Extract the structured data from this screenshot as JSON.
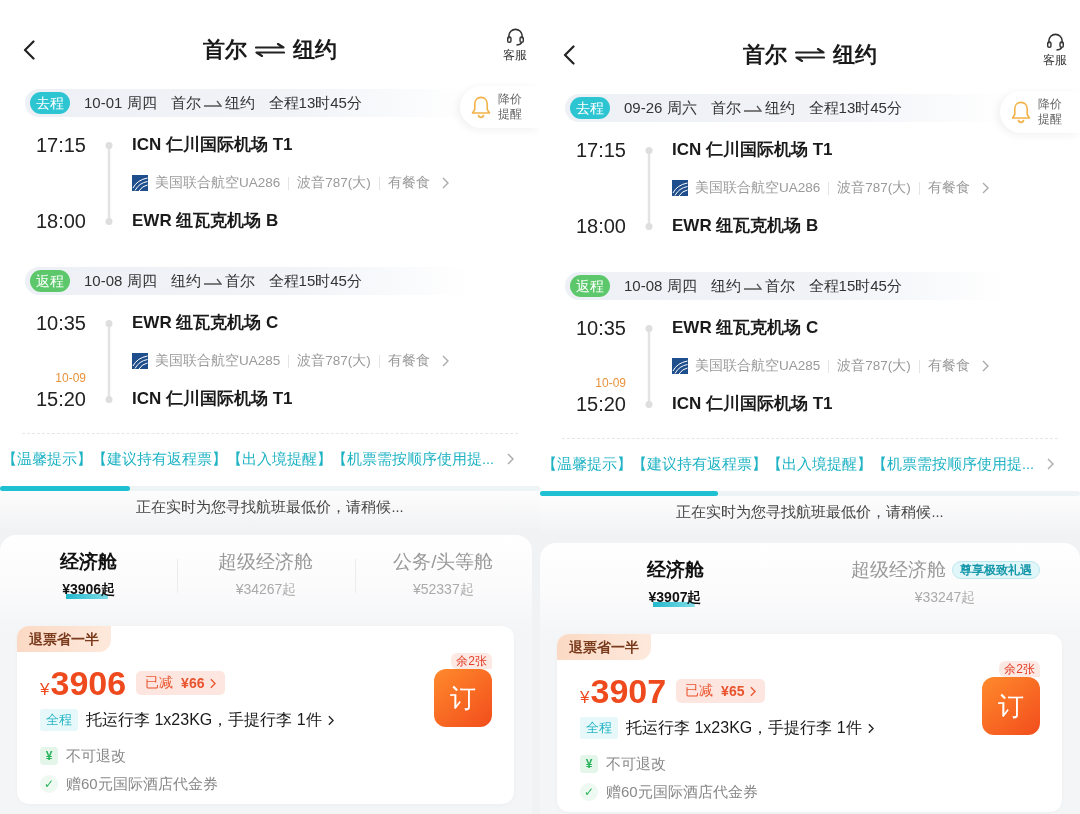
{
  "screens": [
    {
      "header": {
        "from": "首尔",
        "to": "纽约",
        "service": "客服"
      },
      "price_alert": "降价提醒",
      "legs": [
        {
          "tag": "去程",
          "color": "#2ec5d3",
          "date": "10-01 周四",
          "from": "首尔",
          "to": "纽约",
          "duration": "全程13时45分",
          "departure": {
            "time": "17:15",
            "airport": "ICN 仁川国际机场 T1"
          },
          "airline": "美国联合航空UA286",
          "aircraft": "波音787(大)",
          "meal": "有餐食",
          "arrival": {
            "time": "18:00",
            "airport": "EWR 纽瓦克机场 B"
          }
        },
        {
          "tag": "返程",
          "color": "#5cc86b",
          "date": "10-08 周四",
          "from": "纽约",
          "to": "首尔",
          "duration": "全程15时45分",
          "departure": {
            "time": "10:35",
            "airport": "EWR 纽瓦克机场 C"
          },
          "airline": "美国联合航空UA285",
          "aircraft": "波音787(大)",
          "meal": "有餐食",
          "arrival": {
            "time": "15:20",
            "day_note": "10-09",
            "airport": "ICN 仁川国际机场 T1"
          }
        }
      ],
      "notice": "【温馨提示】【建议持有返程票】【出入境提醒】【机票需按顺序使用提...",
      "search_progress": {
        "level": 0.24,
        "message": "正在实时为您寻找航班最低价，请稍候..."
      },
      "cabin_tabs": [
        {
          "name": "经济舱",
          "price": "¥3906起",
          "selected": true
        },
        {
          "name": "超级经济舱",
          "price": "¥34267起",
          "selected": false
        },
        {
          "name": "公务/头等舱",
          "price": "¥52337起",
          "selected": false
        }
      ],
      "fare": {
        "tag": "退票省一半",
        "currency": "¥",
        "price": "3906",
        "discount_label": "已减",
        "discount_amount": "¥66",
        "remaining": "余2张",
        "book": "订",
        "baggage_scope": "全程",
        "baggage": "托运行李 1x23KG，手提行李 1件",
        "features": [
          {
            "kind": "yen",
            "icon": "¥",
            "text": "不可退改"
          },
          {
            "kind": "check",
            "icon": "✓",
            "text": "赠60元国际酒店代金券"
          }
        ]
      }
    },
    {
      "header": {
        "from": "首尔",
        "to": "纽约",
        "service": "客服"
      },
      "price_alert": "降价提醒",
      "legs": [
        {
          "tag": "去程",
          "color": "#2ec5d3",
          "date": "09-26 周六",
          "from": "首尔",
          "to": "纽约",
          "duration": "全程13时45分",
          "departure": {
            "time": "17:15",
            "airport": "ICN 仁川国际机场 T1"
          },
          "airline": "美国联合航空UA286",
          "aircraft": "波音787(大)",
          "meal": "有餐食",
          "arrival": {
            "time": "18:00",
            "airport": "EWR 纽瓦克机场 B"
          }
        },
        {
          "tag": "返程",
          "color": "#5cc86b",
          "date": "10-08 周四",
          "from": "纽约",
          "to": "首尔",
          "duration": "全程15时45分",
          "departure": {
            "time": "10:35",
            "airport": "EWR 纽瓦克机场 C"
          },
          "airline": "美国联合航空UA285",
          "aircraft": "波音787(大)",
          "meal": "有餐食",
          "arrival": {
            "time": "15:20",
            "day_note": "10-09",
            "airport": "ICN 仁川国际机场 T1"
          }
        }
      ],
      "notice": "【温馨提示】【建议持有返程票】【出入境提醒】【机票需按顺序使用提...",
      "search_progress": {
        "level": 0.33,
        "message": "正在实时为您寻找航班最低价，请稍候..."
      },
      "cabin_tabs": [
        {
          "name": "经济舱",
          "price": "¥3907起",
          "selected": true
        },
        {
          "name": "超级经济舱",
          "price": "¥33247起",
          "badge": "尊享极致礼遇",
          "selected": false
        }
      ],
      "fare": {
        "tag": "退票省一半",
        "currency": "¥",
        "price": "3907",
        "discount_label": "已减",
        "discount_amount": "¥65",
        "remaining": "余2张",
        "book": "订",
        "baggage_scope": "全程",
        "baggage": "托运行李 1x23KG，手提行李 1件",
        "features": [
          {
            "kind": "yen",
            "icon": "¥",
            "text": "不可退改"
          },
          {
            "kind": "check",
            "icon": "✓",
            "text": "赠60元国际酒店代金券"
          }
        ]
      }
    }
  ]
}
